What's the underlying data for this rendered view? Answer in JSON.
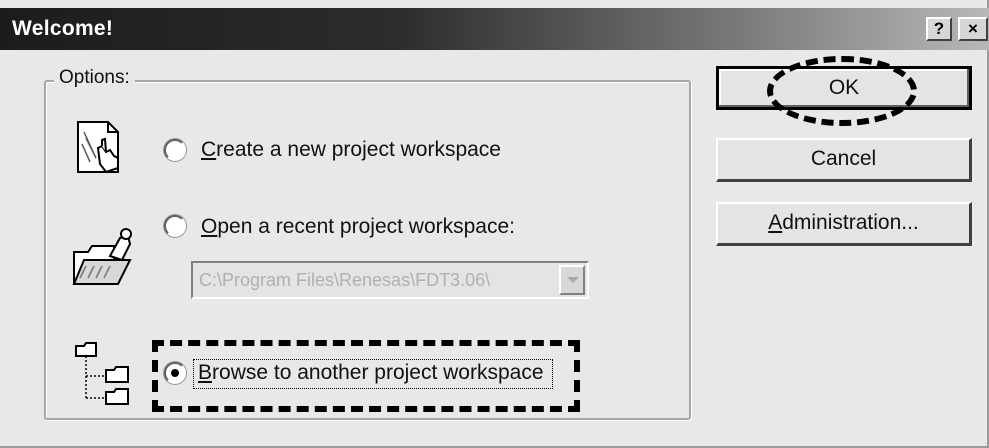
{
  "window": {
    "title": "Welcome!",
    "help_glyph": "?",
    "close_glyph": "×"
  },
  "options": {
    "group_label": "Options:",
    "items": [
      {
        "label": "Create a new project workspace",
        "mnemonic": "C",
        "selected": false,
        "icon": "new-project-icon"
      },
      {
        "label": "Open a recent project workspace:",
        "mnemonic": "O",
        "selected": false,
        "icon": "open-folder-icon"
      },
      {
        "label": "Browse to another project workspace",
        "mnemonic": "B",
        "selected": true,
        "icon": "folder-tree-icon"
      }
    ],
    "recent_path": "C:\\Program Files\\Renesas\\FDT3.06\\"
  },
  "buttons": {
    "ok": "OK",
    "cancel": "Cancel",
    "administration": "Administration..."
  },
  "colors": {
    "dialog_bg": "#e8e8e8",
    "titlebar_dark": "#1c1c1c",
    "titlebar_light": "#b8b8b8",
    "highlight_outline": "#000000"
  }
}
